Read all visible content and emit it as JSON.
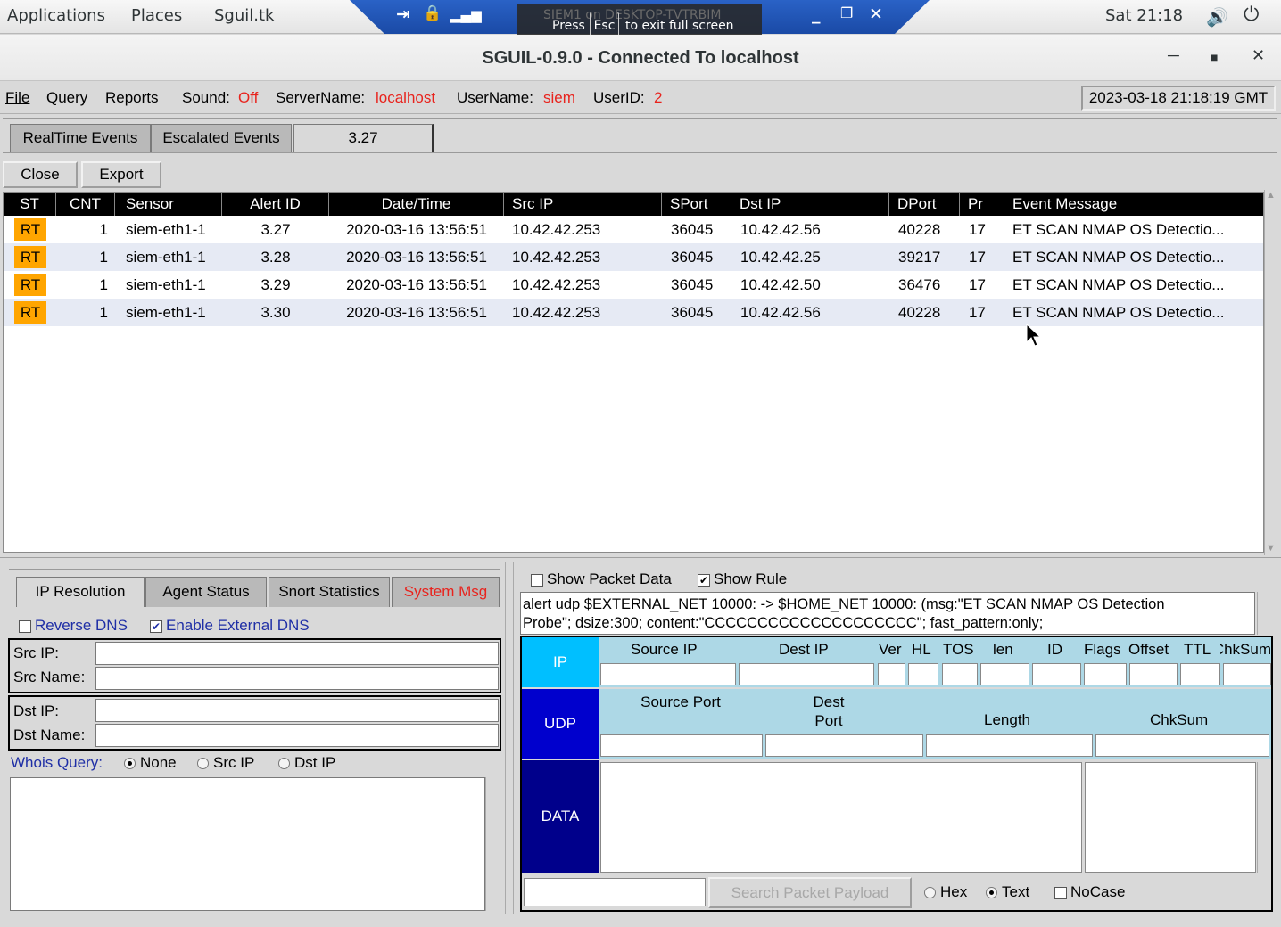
{
  "topbar": {
    "applications": "Applications",
    "places": "Places",
    "app": "Sguil.tk",
    "clock": "Sat 21:18"
  },
  "vm": {
    "ghost_title": "SIEM1 on DESKTOP-TVTRBIM",
    "press": "Press",
    "esc": "Esc",
    "exit": "to exit full screen"
  },
  "window": {
    "title": "SGUIL-0.9.0 - Connected To localhost"
  },
  "menu": {
    "file": "File",
    "query": "Query",
    "reports": "Reports",
    "sound_label": "Sound:",
    "sound_value": "Off",
    "server_label": "ServerName:",
    "server_value": "localhost",
    "user_label": "UserName:",
    "user_value": "siem",
    "uid_label": "UserID:",
    "uid_value": "2",
    "datetime": "2023-03-18 21:18:19 GMT"
  },
  "tabs": [
    "RealTime Events",
    "Escalated Events",
    "3.27"
  ],
  "buttons": {
    "close": "Close",
    "export": "Export"
  },
  "events": {
    "columns": [
      "ST",
      "CNT",
      "Sensor",
      "Alert ID",
      "Date/Time",
      "Src IP",
      "SPort",
      "Dst IP",
      "DPort",
      "Pr",
      "Event Message"
    ],
    "rows": [
      [
        "RT",
        "1",
        "siem-eth1-1",
        "3.27",
        "2020-03-16 13:56:51",
        "10.42.42.253",
        "36045",
        "10.42.42.56",
        "40228",
        "17",
        "ET SCAN NMAP OS Detectio..."
      ],
      [
        "RT",
        "1",
        "siem-eth1-1",
        "3.28",
        "2020-03-16 13:56:51",
        "10.42.42.253",
        "36045",
        "10.42.42.25",
        "39217",
        "17",
        "ET SCAN NMAP OS Detectio..."
      ],
      [
        "RT",
        "1",
        "siem-eth1-1",
        "3.29",
        "2020-03-16 13:56:51",
        "10.42.42.253",
        "36045",
        "10.42.42.50",
        "36476",
        "17",
        "ET SCAN NMAP OS Detectio..."
      ],
      [
        "RT",
        "1",
        "siem-eth1-1",
        "3.30",
        "2020-03-16 13:56:51",
        "10.42.42.253",
        "36045",
        "10.42.42.56",
        "40228",
        "17",
        "ET SCAN NMAP OS Detectio..."
      ]
    ]
  },
  "left_tabs": [
    "IP Resolution",
    "Agent Status",
    "Snort Statistics",
    "System Msg"
  ],
  "ipres": {
    "reverse_dns": "Reverse DNS",
    "external_dns": "Enable External DNS",
    "src_ip": "Src IP:",
    "src_name": "Src Name:",
    "dst_ip": "Dst IP:",
    "dst_name": "Dst Name:",
    "whois": "Whois Query:",
    "opt_none": "None",
    "opt_src": "Src IP",
    "opt_dst": "Dst IP"
  },
  "packet": {
    "show_packet": "Show Packet Data",
    "show_rule": "Show Rule",
    "rule_line1": "alert udp $EXTERNAL_NET 10000: -> $HOME_NET 10000: (msg:\"ET SCAN NMAP OS Detection",
    "rule_line2": "Probe\"; dsize:300; content:\"CCCCCCCCCCCCCCCCCCCC\"; fast_pattern:only;",
    "ip_label": "IP",
    "udp_label": "UDP",
    "data_label": "DATA",
    "ip_cols": [
      "Source IP",
      "Dest IP",
      "Ver",
      "HL",
      "TOS",
      "len",
      "ID",
      "Flags",
      "Offset",
      "TTL",
      "ChkSum"
    ],
    "udp_cols": [
      "Source Port",
      "Dest Port",
      "Length",
      "ChkSum"
    ],
    "search_btn": "Search Packet Payload",
    "hex": "Hex",
    "text": "Text",
    "nocase": "NoCase"
  },
  "colors": {
    "rt": "#ffa500",
    "ip_bg": "#00bfff",
    "udp_bg": "#0000cd",
    "data_bg": "#00008b",
    "header_bg": "#add8e6",
    "alert": "#e8231d"
  }
}
